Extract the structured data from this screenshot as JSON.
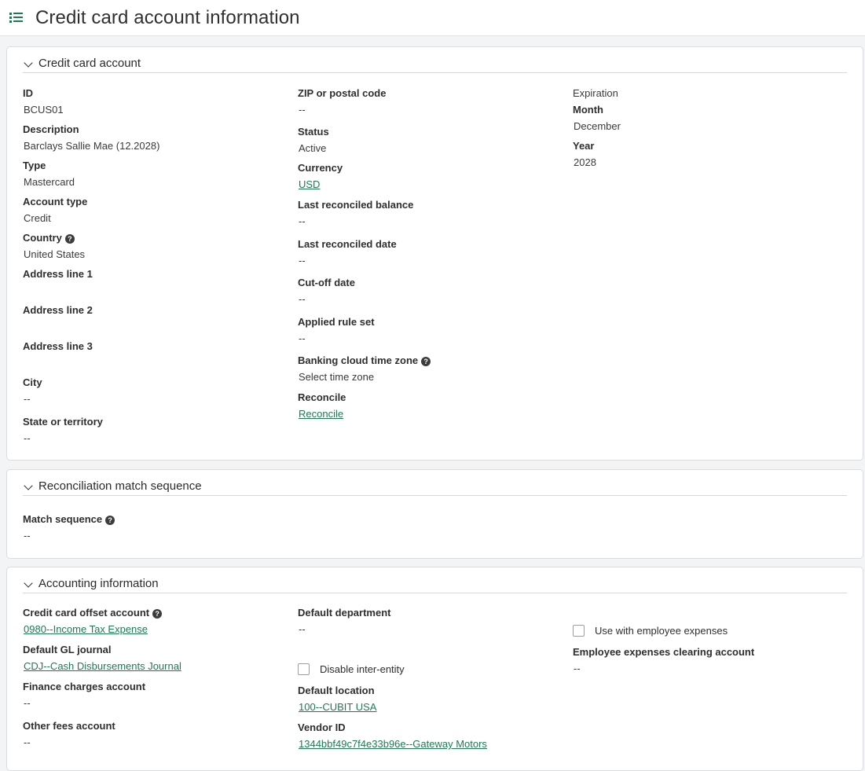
{
  "page": {
    "title": "Credit card account information",
    "menu_icon": "list-icon"
  },
  "credit_card_account": {
    "section_title": "Credit card account",
    "id": {
      "label": "ID",
      "value": "BCUS01"
    },
    "description": {
      "label": "Description",
      "value": "Barclays Sallie Mae (12.2028)"
    },
    "type": {
      "label": "Type",
      "value": "Mastercard"
    },
    "account_type": {
      "label": "Account type",
      "value": "Credit"
    },
    "country": {
      "label": "Country",
      "value": "United States"
    },
    "address1": {
      "label": "Address line 1",
      "value": ""
    },
    "address2": {
      "label": "Address line 2",
      "value": ""
    },
    "address3": {
      "label": "Address line 3",
      "value": ""
    },
    "city": {
      "label": "City",
      "value": "--"
    },
    "state": {
      "label": "State or territory",
      "value": "--"
    },
    "zip": {
      "label": "ZIP or postal code",
      "value": "--"
    },
    "status": {
      "label": "Status",
      "value": "Active"
    },
    "currency": {
      "label": "Currency",
      "value": "USD"
    },
    "last_reconciled_balance": {
      "label": "Last reconciled balance",
      "value": "--"
    },
    "last_reconciled_date": {
      "label": "Last reconciled date",
      "value": "--"
    },
    "cutoff_date": {
      "label": "Cut-off date",
      "value": "--"
    },
    "applied_rule_set": {
      "label": "Applied rule set",
      "value": "--"
    },
    "time_zone": {
      "label": "Banking cloud time zone",
      "value": "Select time zone"
    },
    "reconcile": {
      "label": "Reconcile",
      "value": "Reconcile"
    },
    "expiration": {
      "label": "Expiration",
      "month": {
        "label": "Month",
        "value": "December"
      },
      "year": {
        "label": "Year",
        "value": "2028"
      }
    }
  },
  "reconciliation": {
    "section_title": "Reconciliation match sequence",
    "match_sequence": {
      "label": "Match sequence",
      "value": "--"
    }
  },
  "accounting": {
    "section_title": "Accounting information",
    "offset_account": {
      "label": "Credit card offset account",
      "value": "0980--Income Tax Expense"
    },
    "gl_journal": {
      "label": "Default GL journal",
      "value": "CDJ--Cash Disbursements Journal"
    },
    "finance_charges": {
      "label": "Finance charges account",
      "value": "--"
    },
    "other_fees": {
      "label": "Other fees account",
      "value": "--"
    },
    "default_department": {
      "label": "Default department",
      "value": "--"
    },
    "disable_inter_entity": {
      "label": "Disable inter-entity",
      "checked": false
    },
    "default_location": {
      "label": "Default location",
      "value": "100--CUBIT USA"
    },
    "vendor_id": {
      "label": "Vendor ID",
      "value": "1344bbf49c7f4e33b96e--Gateway Motors"
    },
    "use_with_employee_expenses": {
      "label": "Use with employee expenses",
      "checked": false
    },
    "employee_clearing": {
      "label": "Employee expenses clearing account",
      "value": "--"
    }
  }
}
